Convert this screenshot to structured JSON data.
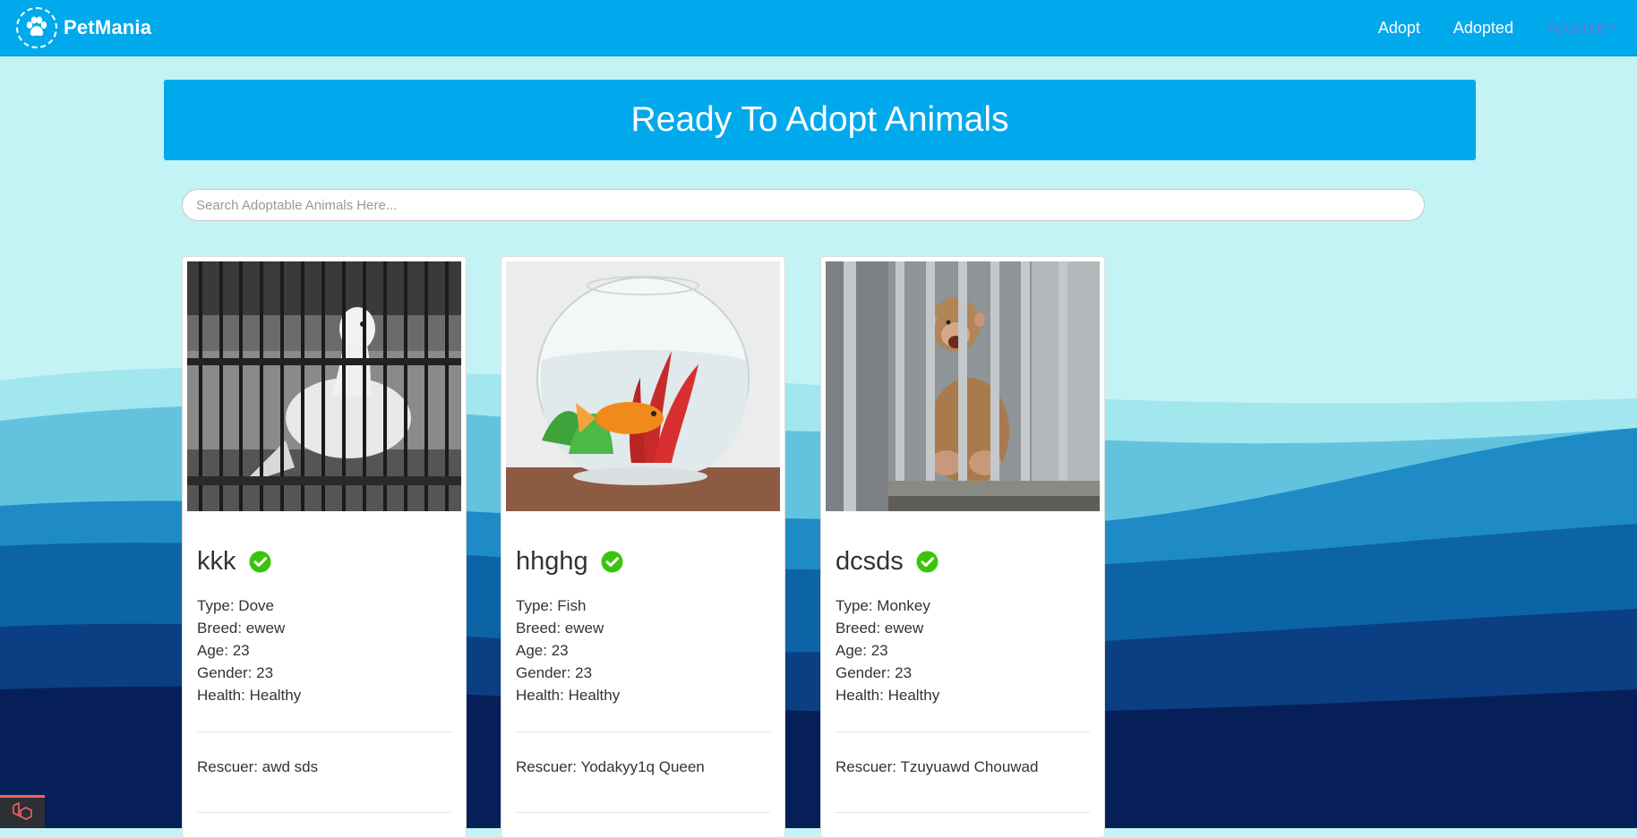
{
  "brand": {
    "name": "PetMania",
    "logo_icon": "paw-icon"
  },
  "nav": {
    "adopt": "Adopt",
    "adopted": "Adopted",
    "account": "Account"
  },
  "banner": {
    "title": "Ready To Adopt Animals"
  },
  "search": {
    "placeholder": "Search Adoptable Animals Here..."
  },
  "cards": [
    {
      "image_icon": "dove-in-cage-photo",
      "name": "kkk",
      "verified_icon": "check-circle-icon",
      "type": "Type: Dove",
      "breed": "Breed: ewew",
      "age": "Age: 23",
      "gender": "Gender: 23",
      "health": "Health: Healthy",
      "rescuer": "Rescuer: awd sds"
    },
    {
      "image_icon": "goldfish-bowl-photo",
      "name": "hhghg",
      "verified_icon": "check-circle-icon",
      "type": "Type: Fish",
      "breed": "Breed: ewew",
      "age": "Age: 23",
      "gender": "Gender: 23",
      "health": "Health: Healthy",
      "rescuer": "Rescuer: Yodakyy1q Queen"
    },
    {
      "image_icon": "monkey-behind-bars-photo",
      "name": "dcsds",
      "verified_icon": "check-circle-icon",
      "type": "Type: Monkey",
      "breed": "Breed: ewew",
      "age": "Age: 23",
      "gender": "Gender: 23",
      "health": "Health: Healthy",
      "rescuer": "Rescuer: Tzuyuawd Chouwad"
    }
  ],
  "colors": {
    "primary": "#00a9ec",
    "background_top": "#c4f3f6",
    "verified": "#3cc40d",
    "account_link": "#5a79d8"
  },
  "debug_badge_icon": "laravel-icon"
}
